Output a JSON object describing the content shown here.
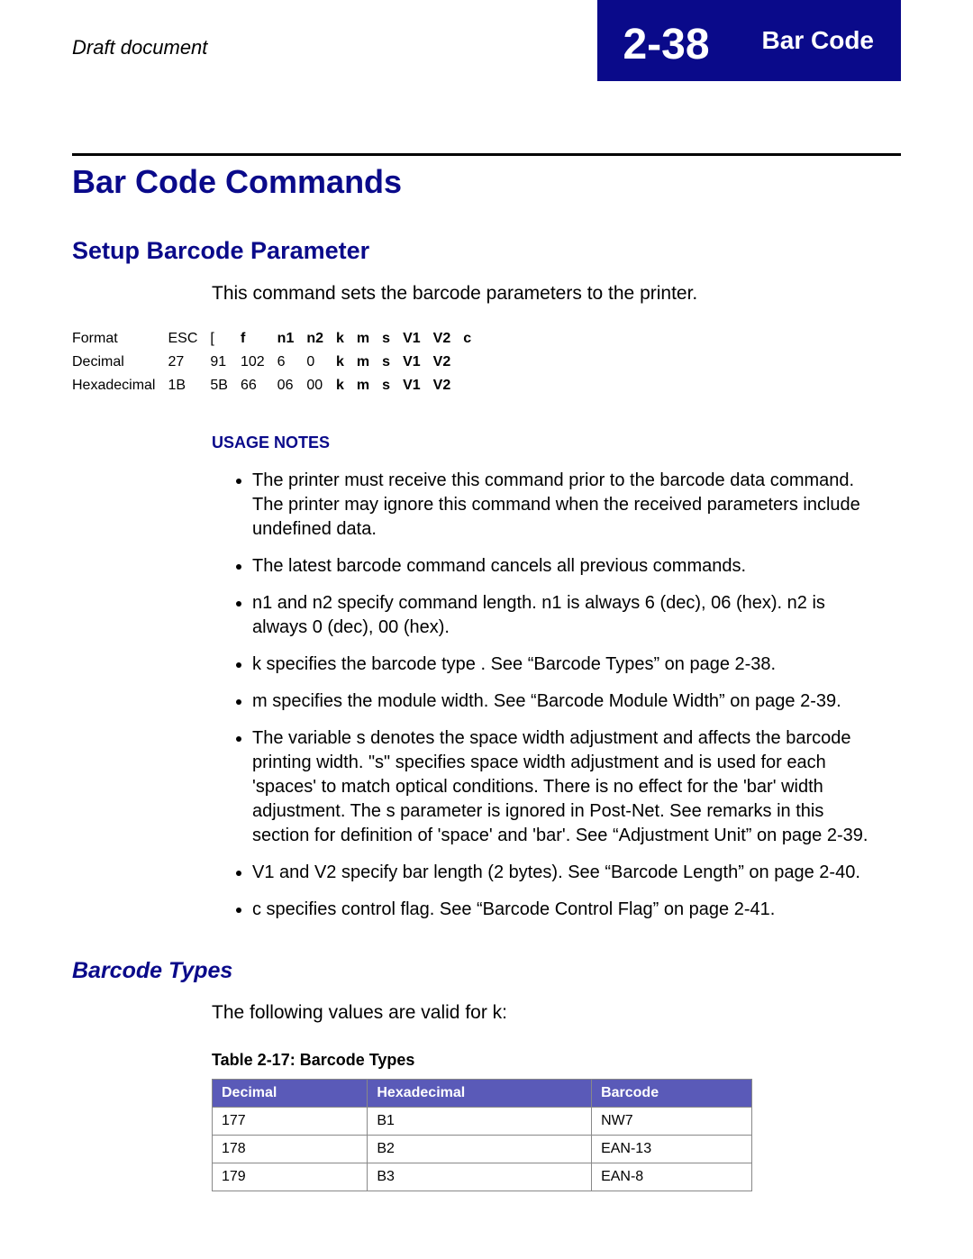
{
  "header": {
    "draft": "Draft document",
    "page_num": "2-38",
    "section": "Bar Code"
  },
  "h1": "Bar Code Commands",
  "h2": "Setup Barcode Parameter",
  "intro": "This command sets the barcode parameters to the printer.",
  "fmt": {
    "rows": [
      {
        "label": "Format",
        "c1": "ESC",
        "c2": "[",
        "c3": "f",
        "c4": "n1",
        "c5": "n2",
        "c6": "k",
        "c7": "m",
        "c8": "s",
        "c9": "V1",
        "c10": "V2",
        "c11": "c",
        "bold_from": 3
      },
      {
        "label": "Decimal",
        "c1": "27",
        "c2": "91",
        "c3": "102",
        "c4": "6",
        "c5": "0",
        "c6": "k",
        "c7": "m",
        "c8": "s",
        "c9": "V1",
        "c10": "V2",
        "c11": "",
        "bold_from": 6
      },
      {
        "label": "Hexadecimal",
        "c1": "1B",
        "c2": "5B",
        "c3": "66",
        "c4": "06",
        "c5": "00",
        "c6": "k",
        "c7": "m",
        "c8": "s",
        "c9": "V1",
        "c10": "V2",
        "c11": "",
        "bold_from": 6
      }
    ]
  },
  "usage_heading": "USAGE NOTES",
  "usage": [
    "The printer must receive this command prior to the barcode data command. The printer may ignore this command when the received parameters include undefined data.",
    "The latest barcode command cancels all previous commands.",
    "n1 and n2 specify command length.  n1 is always 6 (dec), 06 (hex).  n2 is always 0 (dec), 00 (hex).",
    "k specifies the barcode type . See “Barcode Types” on page 2-38.",
    "m specifies the module width. See “Barcode Module Width” on page 2-39.",
    "The variable s denotes the space width adjustment and affects the barcode printing width. \"s\" specifies space width adjustment and is used for each 'spaces' to match optical conditions.  There is no effect for the 'bar' width adjustment.  The s parameter is ignored in Post-Net.  See remarks in this section for definition of 'space' and 'bar'. See “Adjustment Unit” on page 2-39.",
    "V1 and V2 specify bar length (2 bytes). See “Barcode Length” on page 2-40.",
    "c specifies control flag. See “Barcode Control Flag” on page 2-41."
  ],
  "h3": "Barcode Types",
  "follow": "The following values are valid for k:",
  "table_caption": "Table 2-17:  Barcode Types",
  "types_head": {
    "c1": "Decimal",
    "c2": "Hexadecimal",
    "c3": "Barcode"
  },
  "types_rows": [
    {
      "c1": "177",
      "c2": "B1",
      "c3": "NW7"
    },
    {
      "c1": "178",
      "c2": "B2",
      "c3": "EAN-13"
    },
    {
      "c1": "179",
      "c2": "B3",
      "c3": "EAN-8"
    }
  ]
}
